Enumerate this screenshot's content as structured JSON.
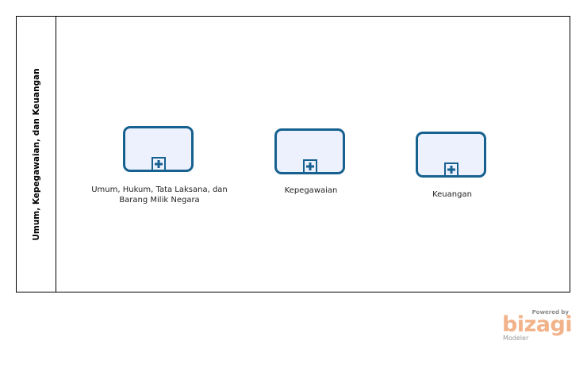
{
  "pool": {
    "lane_title": "Umum, Kepegawaian, dan Keuangan"
  },
  "tasks": [
    {
      "label_line1": "Umum, Hukum, Tata Laksana, dan",
      "label_line2": "Barang Milik Negara"
    },
    {
      "label_line1": "Kepegawaian"
    },
    {
      "label_line1": "Keuangan"
    }
  ],
  "branding": {
    "powered_by": "Powered by",
    "name": "bizagi",
    "product": "Modeler"
  },
  "colors": {
    "task_border": "#16618f",
    "task_fill": "#edf0fd",
    "brand": "#f2b38a"
  },
  "icons": [
    "collapsed-subprocess-plus-icon"
  ]
}
